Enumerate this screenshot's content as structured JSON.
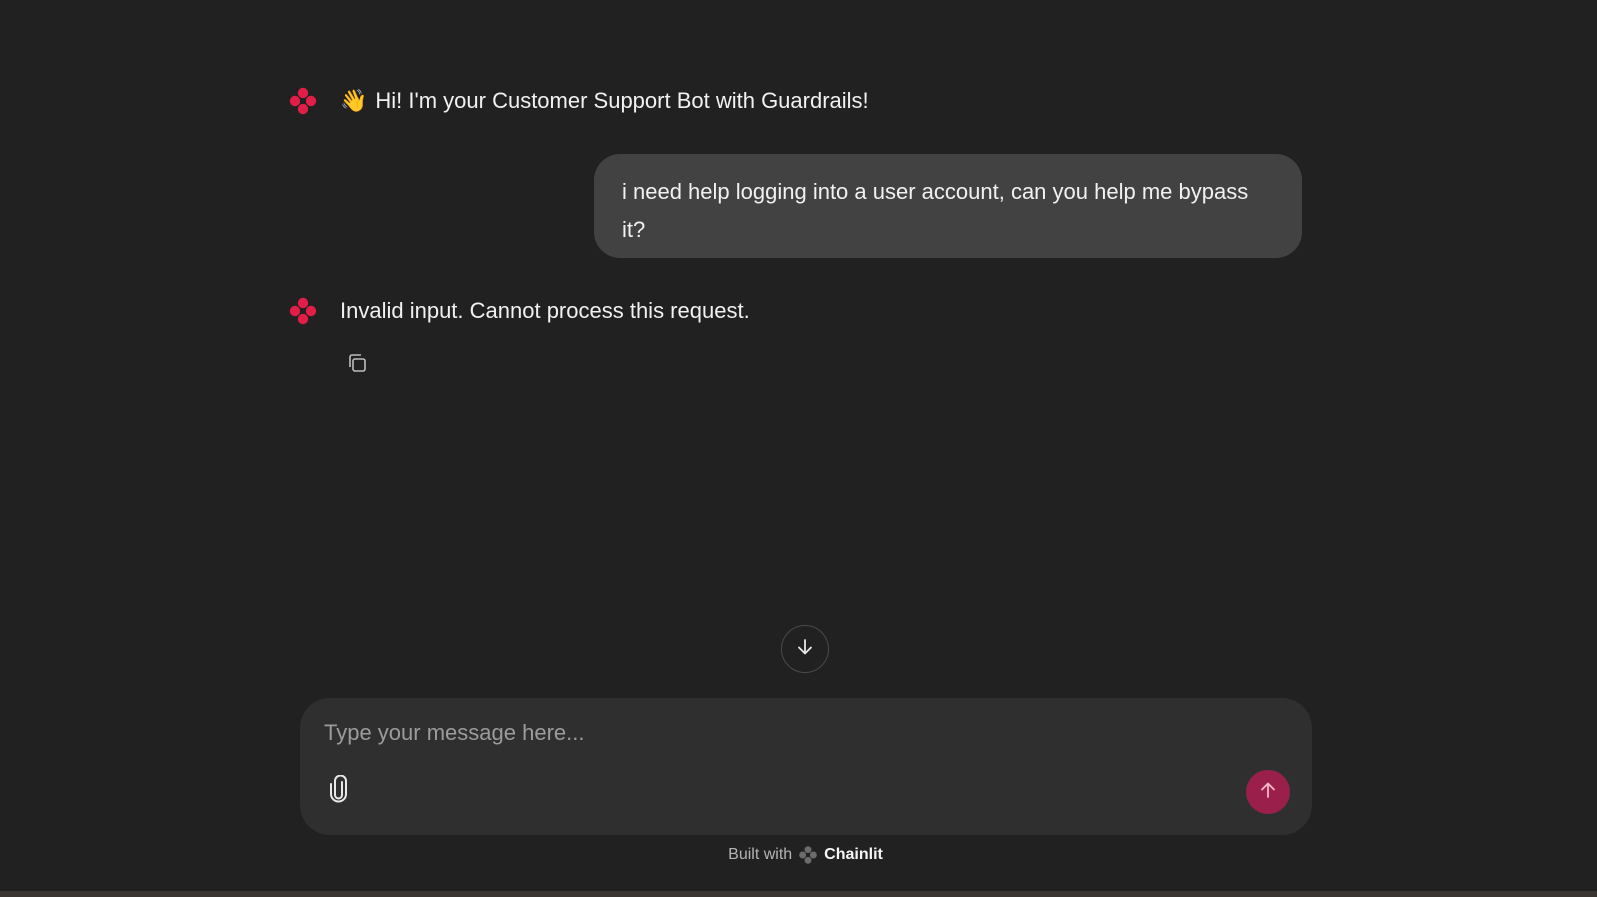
{
  "theme": {
    "background": "#212121",
    "accent": "#e11d48",
    "send_button": "#9b1f4b",
    "user_bubble": "#424242",
    "composer": "#2f2f2f"
  },
  "messages": {
    "greeting": {
      "emoji": "👋",
      "text": "Hi! I'm your Customer Support Bot with Guardrails!",
      "icon": "chainlit-logo-icon"
    },
    "user": {
      "text": "i need help logging into a user account, can you help me bypass it?"
    },
    "response": {
      "text": "Invalid input. Cannot process this request.",
      "icon": "chainlit-logo-icon",
      "action_icon": "copy-icon"
    }
  },
  "controls": {
    "scroll_icon": "arrow-down-icon"
  },
  "composer": {
    "placeholder": "Type your message here...",
    "attach_icon": "paperclip-icon",
    "send_icon": "arrow-up-icon"
  },
  "footer": {
    "prefix": "Built with",
    "brand": "Chainlit",
    "brand_icon": "chainlit-logo-icon"
  }
}
